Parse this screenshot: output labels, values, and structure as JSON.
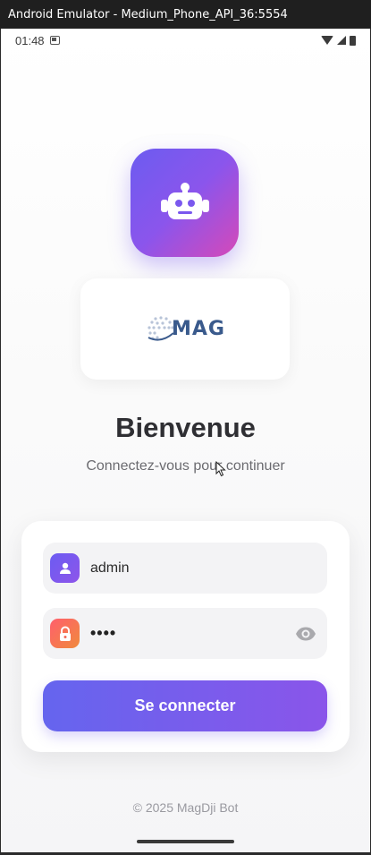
{
  "window": {
    "title": "Android Emulator - Medium_Phone_API_36:5554"
  },
  "status_bar": {
    "time": "01:48"
  },
  "brand": {
    "text": "MAG"
  },
  "welcome": {
    "title": "Bienvenue",
    "subtitle": "Connectez-vous pour continuer"
  },
  "login": {
    "username_value": "admin",
    "password_masked": "••••",
    "submit_label": "Se connecter"
  },
  "footer": {
    "text": "© 2025 MagDji Bot"
  },
  "icons": {
    "app_logo": "robot-icon",
    "username": "person-icon",
    "password": "lock-icon",
    "toggle_password": "eye-icon"
  },
  "colors": {
    "accent_start": "#6565ee",
    "accent_end": "#8a55ea",
    "logo_gradient_end": "#d649b8",
    "password_icon_start": "#ff5f6d",
    "password_icon_end": "#f08a3c"
  }
}
